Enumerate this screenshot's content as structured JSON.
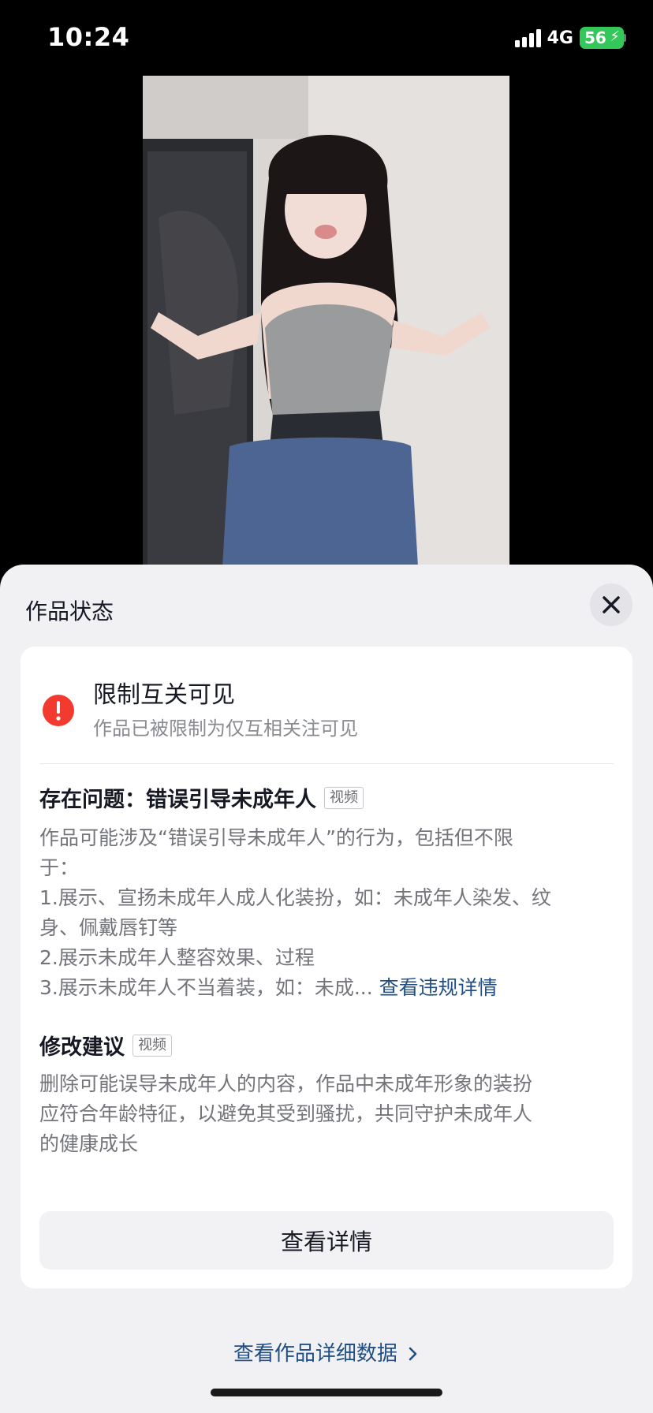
{
  "status_bar": {
    "time": "10:24",
    "network": "4G",
    "battery": "56"
  },
  "video": {
    "description_icon": "video-thumbnail"
  },
  "sheet": {
    "title": "作品状态",
    "status": {
      "title": "限制互关可见",
      "description": "作品已被限制为仅互相关注可见"
    },
    "issue": {
      "label": "存在问题：",
      "name": "错误引导未成年人",
      "tag": "视频",
      "lines": [
        "作品可能涉及“错误引导未成年人”的行为，包括但不限",
        "于：",
        "1.展示、宣扬未成年人成人化装扮，如：未成年人染发、纹",
        "身、佩戴唇钉等",
        "2.展示未成年人整容效果、过程",
        "3.展示未成年人不当着装，如：未成..."
      ],
      "link": "查看违规详情"
    },
    "suggestion": {
      "label": "修改建议",
      "tag": "视频",
      "lines": [
        "删除可能误导未成年人的内容，作品中未成年形象的装扮",
        "应符合年龄特征，以避免其受到骚扰，共同守护未成年人",
        "的健康成长"
      ]
    },
    "detail_button": "查看详情",
    "data_link": "查看作品详细数据",
    "colors": {
      "alert": "#f23a2f",
      "link": "#1f4f86",
      "battery": "#34c759"
    }
  }
}
